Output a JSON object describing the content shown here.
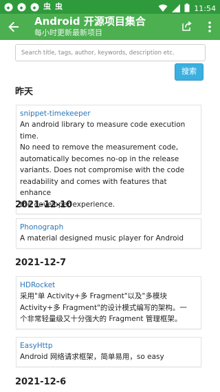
{
  "status_bar": {
    "icons": [
      "android-icon",
      "android-icon",
      "android-icon"
    ],
    "chars": [
      "虫",
      "虫"
    ],
    "time": "11:54"
  },
  "app_bar": {
    "title": "Android 开源项目集合",
    "subtitle": "每小时更新最新项目"
  },
  "search": {
    "placeholder": "Search title, tags, author, keywords, description etc.",
    "button_label": "搜索"
  },
  "sections": [
    {
      "date": "昨天",
      "items": [
        {
          "name": "snippet-timekeeper",
          "desc_lines": [
            "An android library to measure code execution time.",
            "No need to remove the measurement code,",
            "automatically becomes no-op in the release",
            "variants. Does not compromise with the code",
            "readability and comes with features that enhance",
            "the developer experience."
          ]
        }
      ]
    },
    {
      "date": "2021-12-10",
      "items": [
        {
          "name": "Phonograph",
          "desc_lines": [
            "A material designed music player for Android"
          ]
        }
      ]
    },
    {
      "date": "2021-12-7",
      "items": [
        {
          "name": "HDRocket",
          "desc_lines": [
            "采用\"单 Activity+多 Fragment\"以及\"多模块",
            "Activity+多 Fragment\"的设计模式编写的架构。一",
            "个非常轻量级又十分强大的 Fragment 管理框架。"
          ]
        },
        {
          "name": "EasyHttp",
          "desc_lines": [
            "Android 网络请求框架，简单易用，so easy"
          ]
        }
      ]
    },
    {
      "date": "2021-12-6",
      "items": []
    }
  ]
}
